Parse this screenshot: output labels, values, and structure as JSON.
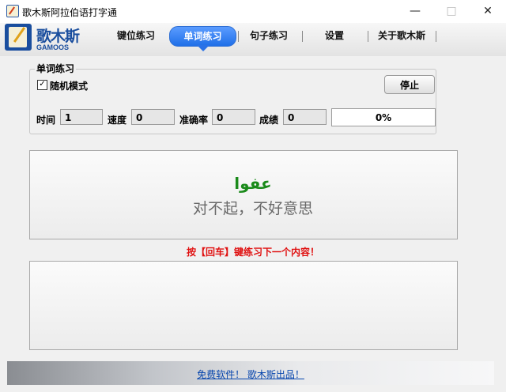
{
  "window": {
    "title": "歌木斯阿拉伯语打字通",
    "minimize_glyph": "—",
    "maximize_glyph": "□",
    "close_glyph": "✕"
  },
  "logo": {
    "text": "歌木斯",
    "subtext": "GAMOOS"
  },
  "nav": {
    "items": [
      {
        "label": "键位练习",
        "active": false
      },
      {
        "label": "单词练习",
        "active": true
      },
      {
        "label": "句子练习",
        "active": false
      },
      {
        "label": "设置",
        "active": false
      },
      {
        "label": "关于歌木斯",
        "active": false
      }
    ]
  },
  "practice": {
    "group_title": "单词练习",
    "random_mode": {
      "label": "随机模式",
      "checked": true,
      "check_glyph": "✓"
    },
    "stop_button": "停止",
    "stats": {
      "time_label": "时间",
      "time_value": "1",
      "speed_label": "速度",
      "speed_value": "0",
      "accuracy_label": "准确率",
      "accuracy_value": "0",
      "score_label": "成绩",
      "score_value": "0"
    },
    "progress": {
      "text": "0%",
      "fraction": 0
    }
  },
  "word": {
    "arabic": "عفوا",
    "meaning": "对不起，不好意思"
  },
  "hint": "按【回车】键练习下一个内容！",
  "footer": {
    "link": "免费软件！ 歌木斯出品！"
  },
  "colors": {
    "accent": "#1f6fe8",
    "arabic_text": "#1a8a1a",
    "hint_text": "#e01010",
    "link": "#0645ad"
  }
}
